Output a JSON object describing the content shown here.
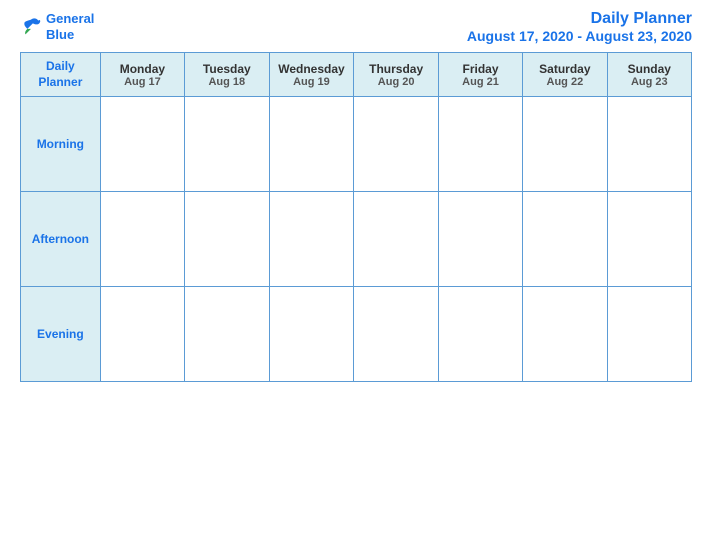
{
  "header": {
    "logo_general": "General",
    "logo_blue": "Blue",
    "title": "Daily Planner",
    "date_range": "August 17, 2020 - August 23, 2020"
  },
  "table": {
    "label_row1": "Daily",
    "label_row2": "Planner",
    "columns": [
      {
        "day": "Monday",
        "date": "Aug 17"
      },
      {
        "day": "Tuesday",
        "date": "Aug 18"
      },
      {
        "day": "Wednesday",
        "date": "Aug 19"
      },
      {
        "day": "Thursday",
        "date": "Aug 20"
      },
      {
        "day": "Friday",
        "date": "Aug 21"
      },
      {
        "day": "Saturday",
        "date": "Aug 22"
      },
      {
        "day": "Sunday",
        "date": "Aug 23"
      }
    ],
    "rows": [
      {
        "label": "Morning"
      },
      {
        "label": "Afternoon"
      },
      {
        "label": "Evening"
      }
    ]
  }
}
